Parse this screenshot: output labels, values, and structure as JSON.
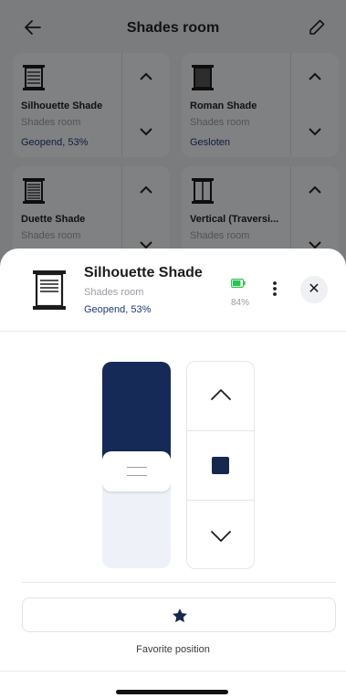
{
  "header": {
    "title": "Shades room"
  },
  "cards": [
    {
      "name": "Silhouette Shade",
      "room": "Shades room",
      "status": "Geopend, 53%"
    },
    {
      "name": "Roman Shade",
      "room": "Shades room",
      "status": "Gesloten"
    },
    {
      "name": "Duette Shade",
      "room": "Shades room",
      "status": ""
    },
    {
      "name": "Vertical (Traversi...",
      "room": "Shades room",
      "status": ""
    }
  ],
  "sheet": {
    "name": "Silhouette Shade",
    "room": "Shades room",
    "status": "Geopend, 53%",
    "battery_text": "84%",
    "battery_level": 0.84,
    "position_percent": 53,
    "favorite_label": "Favorite position"
  },
  "colors": {
    "accent": "#152a56",
    "status_text": "#1d3a78",
    "battery": "#2bc254"
  },
  "icons": {
    "back": "arrow-left-icon",
    "edit": "pencil-icon",
    "up": "chevron-up-icon",
    "down": "chevron-down-icon",
    "stop": "stop-icon",
    "close": "close-icon",
    "more": "more-vertical-icon",
    "favorite": "star-icon",
    "battery": "battery-icon"
  }
}
